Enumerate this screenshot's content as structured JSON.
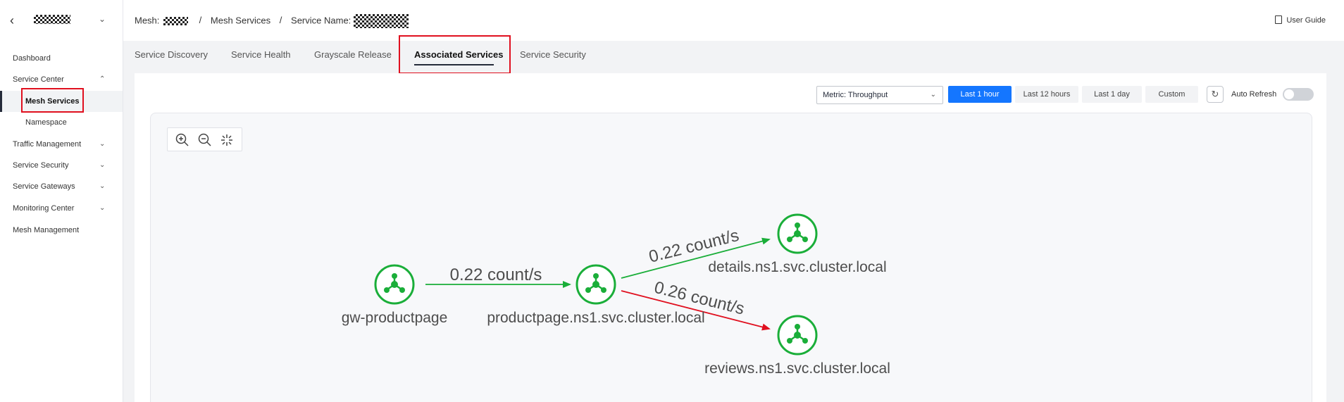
{
  "sidebar": {
    "back_icon": "chevron-left-icon",
    "items": [
      {
        "label": "Dashboard"
      },
      {
        "label": "Service Center",
        "expanded": true
      },
      {
        "label": "Mesh Services",
        "active": true
      },
      {
        "label": "Namespace"
      },
      {
        "label": "Traffic Management"
      },
      {
        "label": "Service Security"
      },
      {
        "label": "Service Gateways"
      },
      {
        "label": "Monitoring Center"
      },
      {
        "label": "Mesh Management"
      }
    ]
  },
  "breadcrumb": {
    "mesh_label": "Mesh:",
    "separator": "/",
    "services_label": "Mesh Services",
    "service_name_label": "Service Name:"
  },
  "header": {
    "user_guide": "User Guide"
  },
  "tabs": [
    {
      "label": "Service Discovery"
    },
    {
      "label": "Service Health"
    },
    {
      "label": "Grayscale Release"
    },
    {
      "label": "Associated Services",
      "active": true
    },
    {
      "label": "Service Security"
    }
  ],
  "toolbar": {
    "metric_select": "Metric: Throughput",
    "time_ranges": [
      "Last 1 hour",
      "Last 12 hours",
      "Last 1 day",
      "Custom"
    ],
    "active_time_range": "Last 1 hour",
    "auto_refresh_label": "Auto Refresh",
    "auto_refresh_on": false
  },
  "graph": {
    "nodes": [
      {
        "id": "gw",
        "label": "gw-productpage"
      },
      {
        "id": "pp",
        "label": "productpage.ns1.svc.cluster.local"
      },
      {
        "id": "details",
        "label": "details.ns1.svc.cluster.local"
      },
      {
        "id": "reviews",
        "label": "reviews.ns1.svc.cluster.local"
      }
    ],
    "edges": [
      {
        "from": "gw",
        "to": "pp",
        "label": "0.22 count/s",
        "status": "healthy"
      },
      {
        "from": "pp",
        "to": "details",
        "label": "0.22 count/s",
        "status": "healthy"
      },
      {
        "from": "pp",
        "to": "reviews",
        "label": "0.26 count/s",
        "status": "error"
      }
    ]
  },
  "colors": {
    "accent": "#1476ff",
    "healthy": "#1aae39",
    "error": "#e0101f",
    "highlight_box": "#e0101f"
  }
}
